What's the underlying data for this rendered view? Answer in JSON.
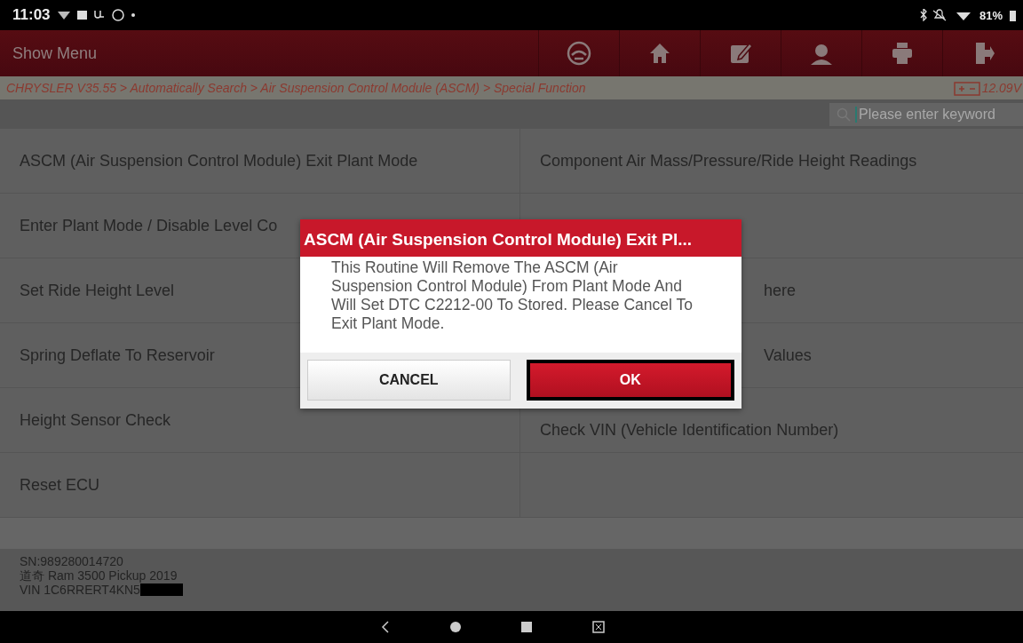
{
  "status_bar": {
    "time": "11:03",
    "battery": "81%"
  },
  "header": {
    "menu_label": "Show Menu"
  },
  "breadcrumb": {
    "path": "CHRYSLER V35.55 > Automatically Search > Air Suspension Control Module (ASCM) > Special Function",
    "voltage": "12.09V"
  },
  "search": {
    "placeholder": "Please enter keyword"
  },
  "functions": [
    [
      {
        "kind": "plain",
        "text": "ASCM (Air Suspension Control Module) Exit Plant Mode"
      },
      {
        "kind": "plain",
        "text": "Component Air Mass/Pressure/Ride Height Readings"
      }
    ],
    [
      {
        "kind": "plain",
        "text": "Enter Plant Mode / Disable Level Co"
      },
      {
        "kind": "empty"
      }
    ],
    [
      {
        "kind": "plain",
        "text": "Set Ride Height Level"
      },
      {
        "kind": "behind_dialog",
        "text": "here"
      }
    ],
    [
      {
        "kind": "plain",
        "text": "Spring Deflate To Reservoir"
      },
      {
        "kind": "behind_dialog",
        "text": "Values"
      }
    ],
    [
      {
        "kind": "plain",
        "text": "Height Sensor Check"
      },
      {
        "kind": "low",
        "text": "Check VIN (Vehicle Identification Number)"
      }
    ],
    [
      {
        "kind": "plain",
        "text": "Reset ECU"
      },
      {
        "kind": "empty"
      }
    ]
  ],
  "footer": {
    "lines": [
      "SN:989280014720",
      "道奇 Ram 3500 Pickup 2019",
      "VIN 1C6RRERT4KN5"
    ]
  },
  "dialog": {
    "title": "ASCM (Air Suspension Control Module) Exit Pl...",
    "message": "This Routine Will Remove The ASCM (Air Suspension Control Module) From Plant Mode And Will Set DTC C2212-00 To Stored. Please Cancel To Exit Plant Mode.",
    "buttons": [
      {
        "label": "CANCEL",
        "selected": false
      },
      {
        "label": "OK",
        "selected": true
      }
    ]
  }
}
